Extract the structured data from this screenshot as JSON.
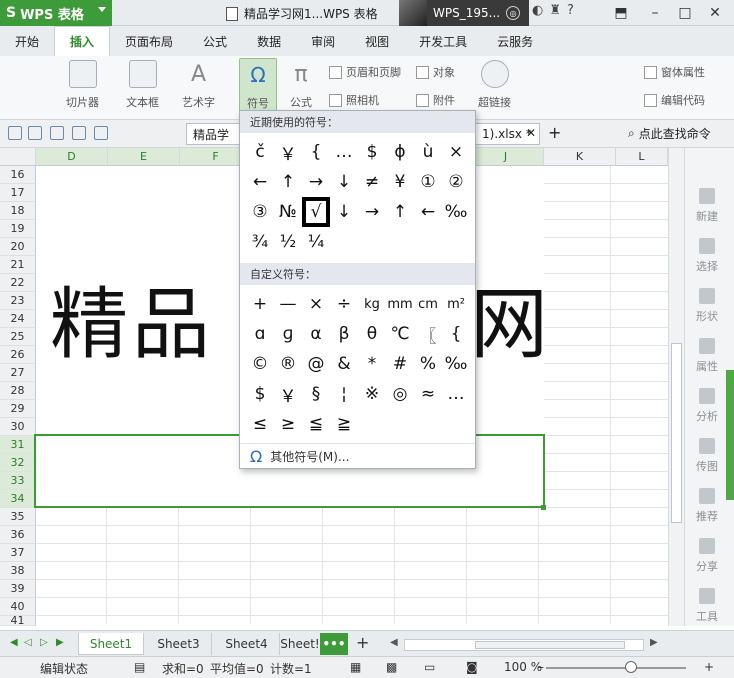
{
  "titlebar": {
    "app_logo": "S",
    "app_name": "WPS 表格",
    "doc_title": "精品学习网1...WPS 表格",
    "user_name": "WPS_195...",
    "help": "?",
    "minimize": "–",
    "maximize": "□",
    "close": "✕"
  },
  "tabs": [
    "开始",
    "插入",
    "页面布局",
    "公式",
    "数据",
    "审阅",
    "视图",
    "开发工具",
    "云服务"
  ],
  "active_tab": "插入",
  "ribbon": {
    "slicer": "切片器",
    "textbox": "文本框",
    "wordart": "艺术字",
    "symbol": "符号",
    "symbol_glyph": "Ω",
    "formula": "公式",
    "formula_glyph": "π",
    "header_footer": "页眉和页脚",
    "object": "对象",
    "camera": "照相机",
    "attachment": "附件",
    "hyperlink": "超链接",
    "form_props": "窗体属性",
    "edit_code": "编辑代码"
  },
  "toolbar": {
    "file_tab": "精品学",
    "file_tab_2": "1).xlsx *",
    "find_cmd": "点此查找命令"
  },
  "columns": [
    "D",
    "E",
    "F",
    "G",
    "H",
    "I",
    "J",
    "K",
    "L"
  ],
  "rows": [
    "16",
    "17",
    "18",
    "19",
    "20",
    "21",
    "22",
    "23",
    "24",
    "25",
    "26",
    "27",
    "28",
    "29",
    "30",
    "31",
    "32",
    "33",
    "34",
    "35",
    "36",
    "37",
    "38",
    "39",
    "40",
    "41"
  ],
  "cell_text": {
    "left": "精品",
    "right": "网"
  },
  "symbol_popup": {
    "recent_title": "近期使用的符号：",
    "recent": [
      "č",
      "￥",
      "{",
      "…",
      "$",
      "ϕ",
      "ù",
      "×",
      "←",
      "↑",
      "→",
      "↓",
      "≠",
      "¥",
      "①",
      "②",
      "③",
      "№",
      "√",
      "↓",
      "→",
      "↑",
      "←",
      "‰",
      "¾",
      "½",
      "¼"
    ],
    "selected_symbol": "√",
    "custom_title": "自定义符号：",
    "custom": [
      "+",
      "—",
      "×",
      "÷",
      "kg",
      "mm",
      "cm",
      "m²",
      "ɑ",
      "ɡ",
      "α",
      "β",
      "θ",
      "℃",
      "〖",
      "{",
      "©",
      "®",
      "@",
      "&",
      "*",
      "#",
      "%",
      "‰",
      "$",
      "￥",
      "§",
      "¦",
      "※",
      "◎",
      "≈",
      "…",
      "≤",
      "≥",
      "≦",
      "≧"
    ],
    "more_symbols": "其他符号(M)...",
    "more_icon": "Ω"
  },
  "side_panel": [
    "新建",
    "选择",
    "形状",
    "属性",
    "分析",
    "传图",
    "推荐",
    "分享",
    "工具"
  ],
  "sheets": [
    "Sheet1",
    "Sheet3",
    "Sheet4",
    "Sheet!"
  ],
  "active_sheet": "Sheet1",
  "sheet_more": "•••",
  "statusbar": {
    "mode": "编辑状态",
    "sum": "求和=0",
    "avg": "平均值=0",
    "count": "计数=1",
    "zoom": "100 %",
    "zoom_minus": "–",
    "zoom_plus": "+"
  }
}
